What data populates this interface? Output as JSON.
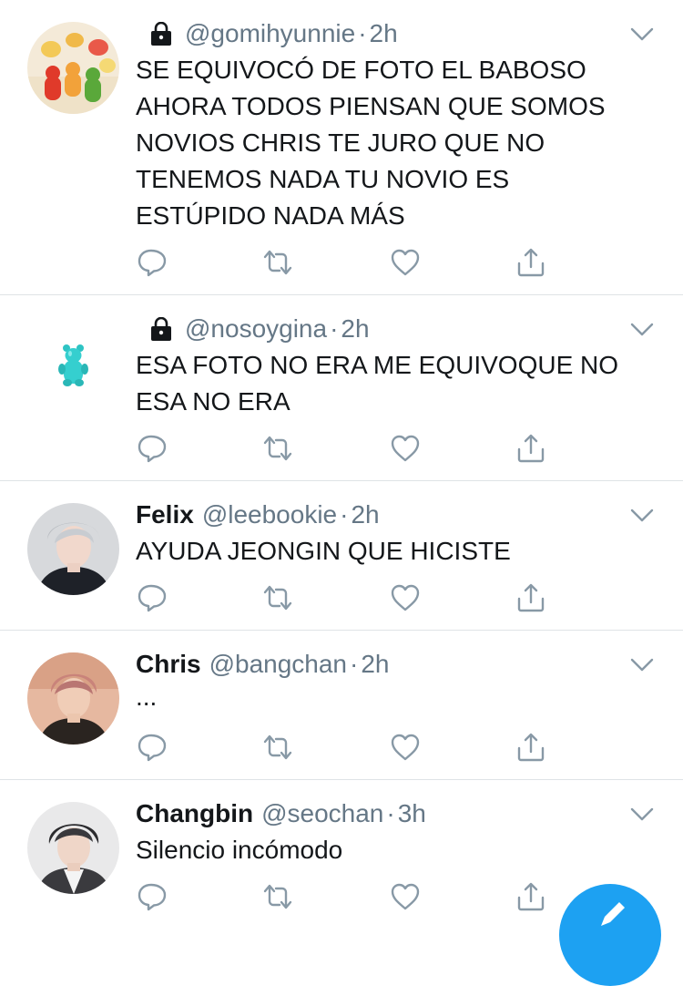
{
  "colors": {
    "text": "#14171a",
    "muted": "#657786",
    "icon": "#8899a6",
    "divider": "#dfe3e6",
    "accent": "#1da1f2"
  },
  "tweets": [
    {
      "display_name": "",
      "handle": "@gomihyunnie",
      "separator": "·",
      "time": "2h",
      "protected": true,
      "avatar": "gummy-bears-avatar",
      "text": "SE EQUIVOCÓ DE FOTO EL BABOSO AHORA TODOS PIENSAN QUE SOMOS NOVIOS CHRIS TE JURO QUE NO TENEMOS NADA TU NOVIO ES ESTÚPIDO NADA MÁS"
    },
    {
      "display_name": "",
      "handle": "@nosoygina",
      "separator": "·",
      "time": "2h",
      "protected": true,
      "avatar": "teal-gummy-bear-avatar",
      "text": "ESA FOTO NO ERA ME EQUIVOQUE NO ESA NO ERA"
    },
    {
      "display_name": "Felix",
      "handle": "@leebookie",
      "separator": "·",
      "time": "2h",
      "protected": false,
      "avatar": "person-photo-avatar",
      "text": "AYUDA JEONGIN QUE HICISTE"
    },
    {
      "display_name": "Chris",
      "handle": "@bangchan",
      "separator": "·",
      "time": "2h",
      "protected": false,
      "avatar": "person-photo-avatar",
      "text": "..."
    },
    {
      "display_name": "Changbin",
      "handle": "@seochan",
      "separator": "·",
      "time": "3h",
      "protected": false,
      "avatar": "person-photo-avatar",
      "text": "Silencio incómodo"
    }
  ],
  "icons": {
    "reply": "reply-icon",
    "retweet": "retweet-icon",
    "like": "like-icon",
    "share": "share-icon",
    "more": "chevron-down-icon",
    "lock": "lock-icon",
    "compose": "compose-tweet-icon"
  }
}
